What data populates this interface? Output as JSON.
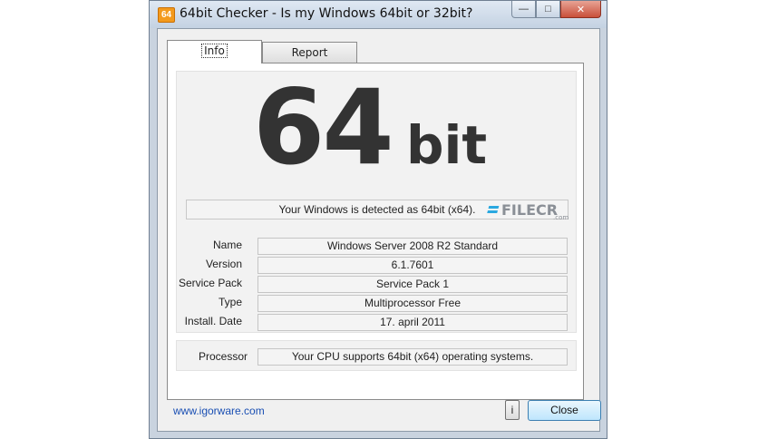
{
  "window": {
    "icon_text": "64",
    "title": "64bit Checker - Is my Windows 64bit or 32bit?",
    "min_glyph": "—",
    "max_glyph": "□",
    "close_glyph": "✕"
  },
  "tabs": [
    {
      "label": "Info",
      "selected": true
    },
    {
      "label": "Report",
      "selected": false
    }
  ],
  "result": {
    "number": "64",
    "unit": "bit",
    "detected_text": "Your Windows is detected as 64bit (x64)."
  },
  "details": [
    {
      "label": "Name",
      "value": "Windows Server 2008 R2 Standard"
    },
    {
      "label": "Version",
      "value": "6.1.7601"
    },
    {
      "label": "Service Pack",
      "value": "Service Pack 1"
    },
    {
      "label": "Type",
      "value": "Multiprocessor Free"
    },
    {
      "label": "Install. Date",
      "value": "17. april 2011"
    }
  ],
  "processor": {
    "label": "Processor",
    "value": "Your CPU supports 64bit (x64) operating systems."
  },
  "footer": {
    "link": "www.igorware.com",
    "info_label": "i",
    "close_label": "Close"
  },
  "watermark": {
    "text": "FILECR",
    "suffix": ".com"
  },
  "colors": {
    "link": "#1a4fb3",
    "big_text": "#333333",
    "watermark_accent": "#2aa8e0"
  }
}
